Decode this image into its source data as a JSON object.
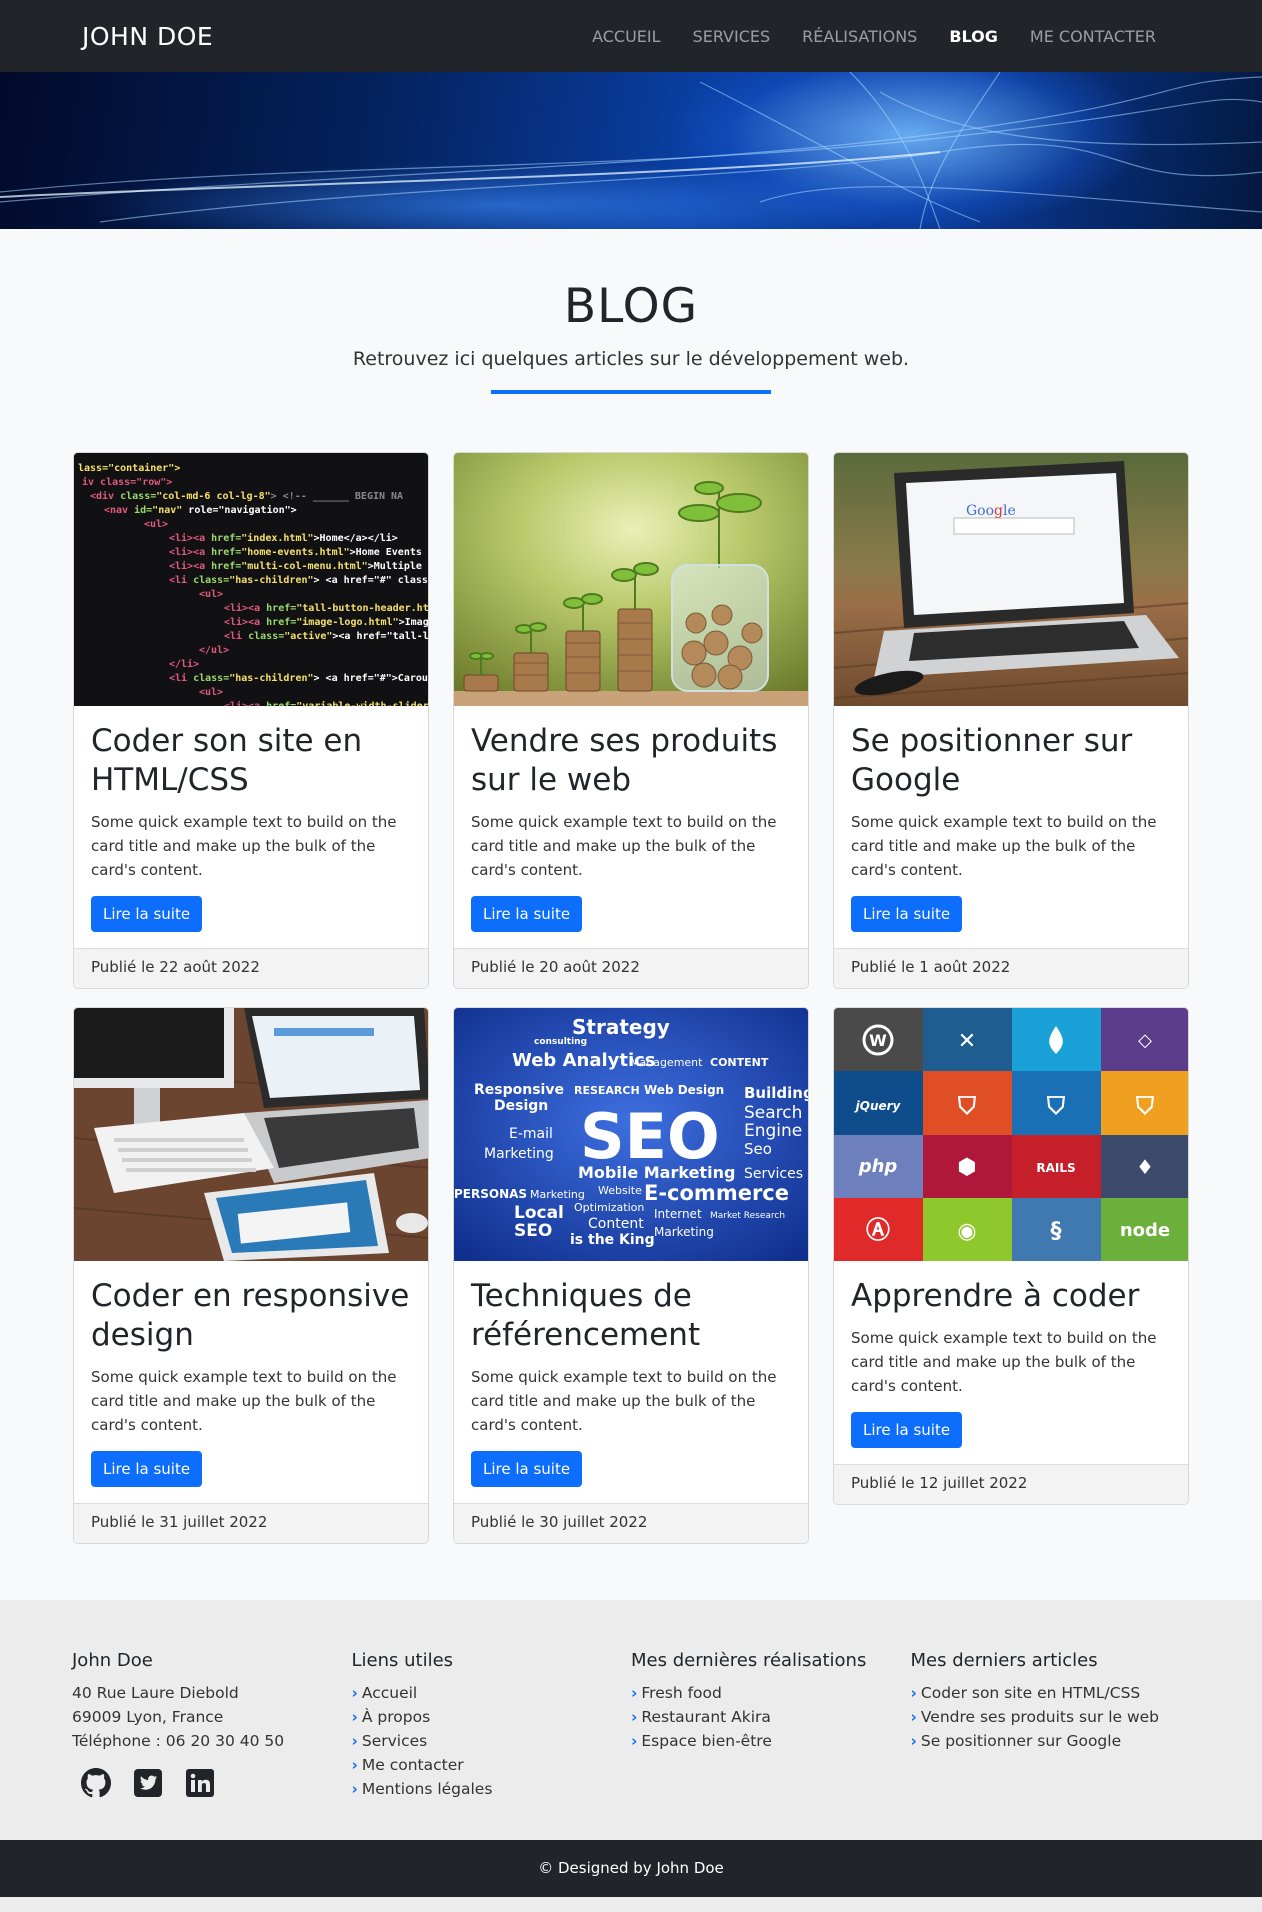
{
  "nav": {
    "brand": "JOHN DOE",
    "items": [
      {
        "label": "ACCUEIL",
        "active": false
      },
      {
        "label": "SERVICES",
        "active": false
      },
      {
        "label": "RÉALISATIONS",
        "active": false
      },
      {
        "label": "BLOG",
        "active": true
      },
      {
        "label": "ME CONTACTER",
        "active": false
      }
    ]
  },
  "header": {
    "title": "BLOG",
    "subtitle": "Retrouvez ici quelques articles sur le développement web."
  },
  "cards": [
    {
      "image": "code-html-screen",
      "title": "Coder son site en HTML/CSS",
      "text": "Some quick example text to build on the card title and make up the bulk of the card's content.",
      "button": "Lire la suite",
      "date": "Publié le 22 août 2022"
    },
    {
      "image": "coins-growing-plants",
      "title": "Vendre ses produits sur le web",
      "text": "Some quick example text to build on the card title and make up the bulk of the card's content.",
      "button": "Lire la suite",
      "date": "Publié le 20 août 2022"
    },
    {
      "image": "laptop-google",
      "title": "Se positionner sur Google",
      "text": "Some quick example text to build on the card title and make up the bulk of the card's content.",
      "button": "Lire la suite",
      "date": "Publié le 1 août 2022"
    },
    {
      "image": "devices-responsive",
      "title": "Coder en responsive design",
      "text": "Some quick example text to build on the card title and make up the bulk of the card's content.",
      "button": "Lire la suite",
      "date": "Publié le 31 juillet 2022"
    },
    {
      "image": "seo-wordcloud",
      "title": "Techniques de référencement",
      "text": "Some quick example text to build on the card title and make up the bulk of the card's content.",
      "button": "Lire la suite",
      "date": "Publié le 30 juillet 2022"
    },
    {
      "image": "tech-logos-grid",
      "title": "Apprendre à coder",
      "text": "Some quick example text to build on the card title and make up the bulk of the card's content.",
      "button": "Lire la suite",
      "date": "Publié le 12 juillet 2022"
    }
  ],
  "footer": {
    "contact": {
      "heading": "John Doe",
      "address1": "40 Rue Laure Diebold",
      "address2": "69009 Lyon, France",
      "phone": "Téléphone : 06 20 30 40 50"
    },
    "links": {
      "heading": "Liens utiles",
      "items": [
        "Accueil",
        "À propos",
        "Services",
        "Me contacter",
        "Mentions légales"
      ]
    },
    "projects": {
      "heading": "Mes dernières réalisations",
      "items": [
        "Fresh food",
        "Restaurant Akira",
        "Espace bien-être"
      ]
    },
    "articles": {
      "heading": "Mes derniers articles",
      "items": [
        "Coder son site en HTML/CSS",
        "Vendre ses produits sur le web",
        "Se positionner sur Google"
      ]
    },
    "social_icons": [
      "github-icon",
      "twitter-icon",
      "linkedin-icon"
    ],
    "copyright": "© Designed by John Doe"
  },
  "colors": {
    "accent": "#0d6efd",
    "dark": "#212529",
    "footer_bg": "#ececec"
  }
}
